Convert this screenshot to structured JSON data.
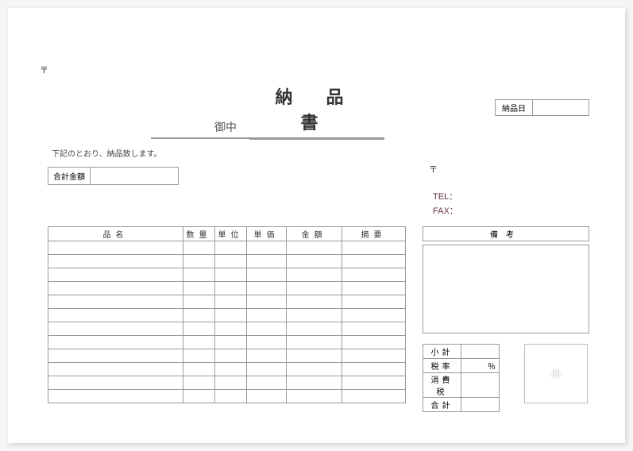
{
  "postal_mark": "〒",
  "title": "納 品 書",
  "date": {
    "label": "納品日",
    "value": ""
  },
  "recipient_suffix": "御中",
  "statement": "下記のとおり、納品致します。",
  "total": {
    "label": "合計金額",
    "value": ""
  },
  "contact": {
    "tel_label": "TEL：",
    "fax_label": "FAX："
  },
  "items_headers": {
    "name": "品名",
    "qty": "数量",
    "unit": "単位",
    "price": "単価",
    "amount": "金額",
    "note": "摘要"
  },
  "remarks_header": "備考",
  "summary": {
    "subtotal_label": "小計",
    "subtotal_value": "",
    "taxrate_label": "税率",
    "taxrate_value": "％",
    "tax_label": "消費税",
    "tax_value": "",
    "total_label": "合計",
    "total_value": ""
  },
  "stamp": "㊞"
}
